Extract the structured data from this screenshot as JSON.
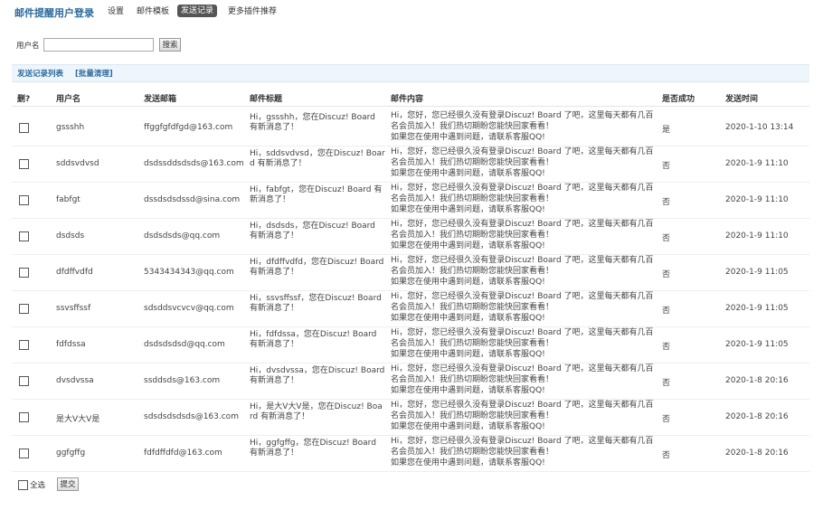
{
  "nav": {
    "app_title": "邮件提醒用户登录",
    "tabs": [
      "设置",
      "邮件模板",
      "发送记录",
      "更多插件推荐"
    ]
  },
  "search": {
    "label": "用户名",
    "value": "",
    "button": "搜索"
  },
  "list": {
    "title": "发送记录列表",
    "bulk_clear": "[批量清理]"
  },
  "table": {
    "headers": [
      "删?",
      "用户名",
      "发送邮箱",
      "邮件标题",
      "邮件内容",
      "是否成功",
      "发送时间"
    ],
    "content_text": "Hi，您好，您已经很久没有登录Discuz! Board 了吧，这里每天都有几百名会员加入！我们热切期盼您能快回家看看！\n如果您在使用中遇到问题，请联系客服QQ!",
    "rows": [
      {
        "user": "gssshh",
        "email": "ffggfgfdfgd@163.com",
        "subject": "Hi，gssshh，您在Discuz! Board 有新消息了！",
        "ok": "是",
        "time": "2020-1-10 13:14"
      },
      {
        "user": "sddsvdvsd",
        "email": "dsdssddsdsds@163.com",
        "subject": "Hi，sddsvdvsd，您在Discuz! Board 有新消息了！",
        "ok": "否",
        "time": "2020-1-9 11:10"
      },
      {
        "user": "fabfgt",
        "email": "dssdsdsdssd@sina.com",
        "subject": "Hi，fabfgt，您在Discuz! Board 有新消息了！",
        "ok": "否",
        "time": "2020-1-9 11:10"
      },
      {
        "user": "dsdsds",
        "email": "dsdsdsds@qq.com",
        "subject": "Hi，dsdsds，您在Discuz! Board 有新消息了！",
        "ok": "否",
        "time": "2020-1-9 11:10"
      },
      {
        "user": "dfdffvdfd",
        "email": "5343434343@qq.com",
        "subject": "Hi，dfdffvdfd，您在Discuz! Board 有新消息了！",
        "ok": "否",
        "time": "2020-1-9 11:05"
      },
      {
        "user": "ssvsffssf",
        "email": "sdsddsvcvcv@qq.com",
        "subject": "Hi，ssvsffssf，您在Discuz! Board 有新消息了！",
        "ok": "否",
        "time": "2020-1-9 11:05"
      },
      {
        "user": "fdfdssa",
        "email": "dsdsdsdsd@qq.com",
        "subject": "Hi，fdfdssa，您在Discuz! Board 有新消息了！",
        "ok": "否",
        "time": "2020-1-9 11:05"
      },
      {
        "user": "dvsdvssa",
        "email": "ssddsds@163.com",
        "subject": "Hi，dvsdvssa，您在Discuz! Board 有新消息了！",
        "ok": "否",
        "time": "2020-1-8 20:16"
      },
      {
        "user": "是大V大V是",
        "email": "sdsdsdsdsds@163.com",
        "subject": "Hi，是大V大V是，您在Discuz! Board 有新消息了！",
        "ok": "否",
        "time": "2020-1-8 20:16"
      },
      {
        "user": "ggfgffg",
        "email": "fdfdffdfd@163.com",
        "subject": "Hi，ggfgffg，您在Discuz! Board 有新消息了！",
        "ok": "否",
        "time": "2020-1-8 20:16"
      }
    ]
  },
  "footer": {
    "select_all": "全选",
    "submit": "提交"
  },
  "colors": {
    "title_blue": "#2b6a9c",
    "active_tab_bg": "#555555",
    "section_bar_bg": "#eef6fc"
  }
}
